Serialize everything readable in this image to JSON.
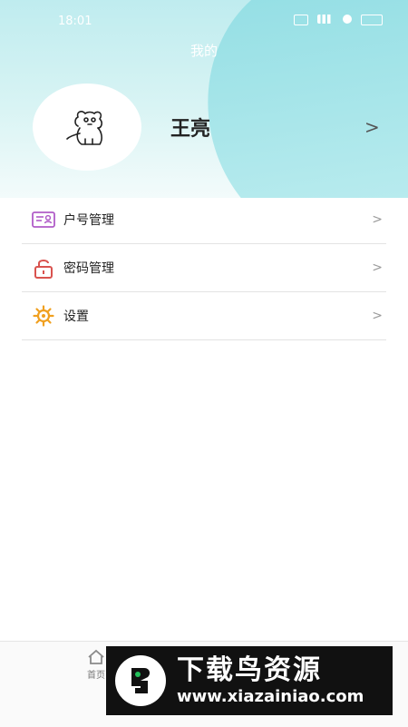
{
  "status_bar": {
    "time": "18:01"
  },
  "header": {
    "title": "我的"
  },
  "profile": {
    "name": "王亮",
    "chevron": ">"
  },
  "menu": [
    {
      "label": "户号管理",
      "icon": "id-card-icon",
      "color": "#b05cc8"
    },
    {
      "label": "密码管理",
      "icon": "lock-icon",
      "color": "#d9534f"
    },
    {
      "label": "设置",
      "icon": "gear-icon",
      "color": "#f0a020"
    }
  ],
  "menu_chevron": ">",
  "bottom_nav": {
    "home_label": "首页"
  },
  "watermark": {
    "title": "下载鸟资源",
    "url": "www.xiazainiao.com"
  },
  "colors": {
    "header_top": "#bfecef",
    "accent": "#8fdde3"
  }
}
